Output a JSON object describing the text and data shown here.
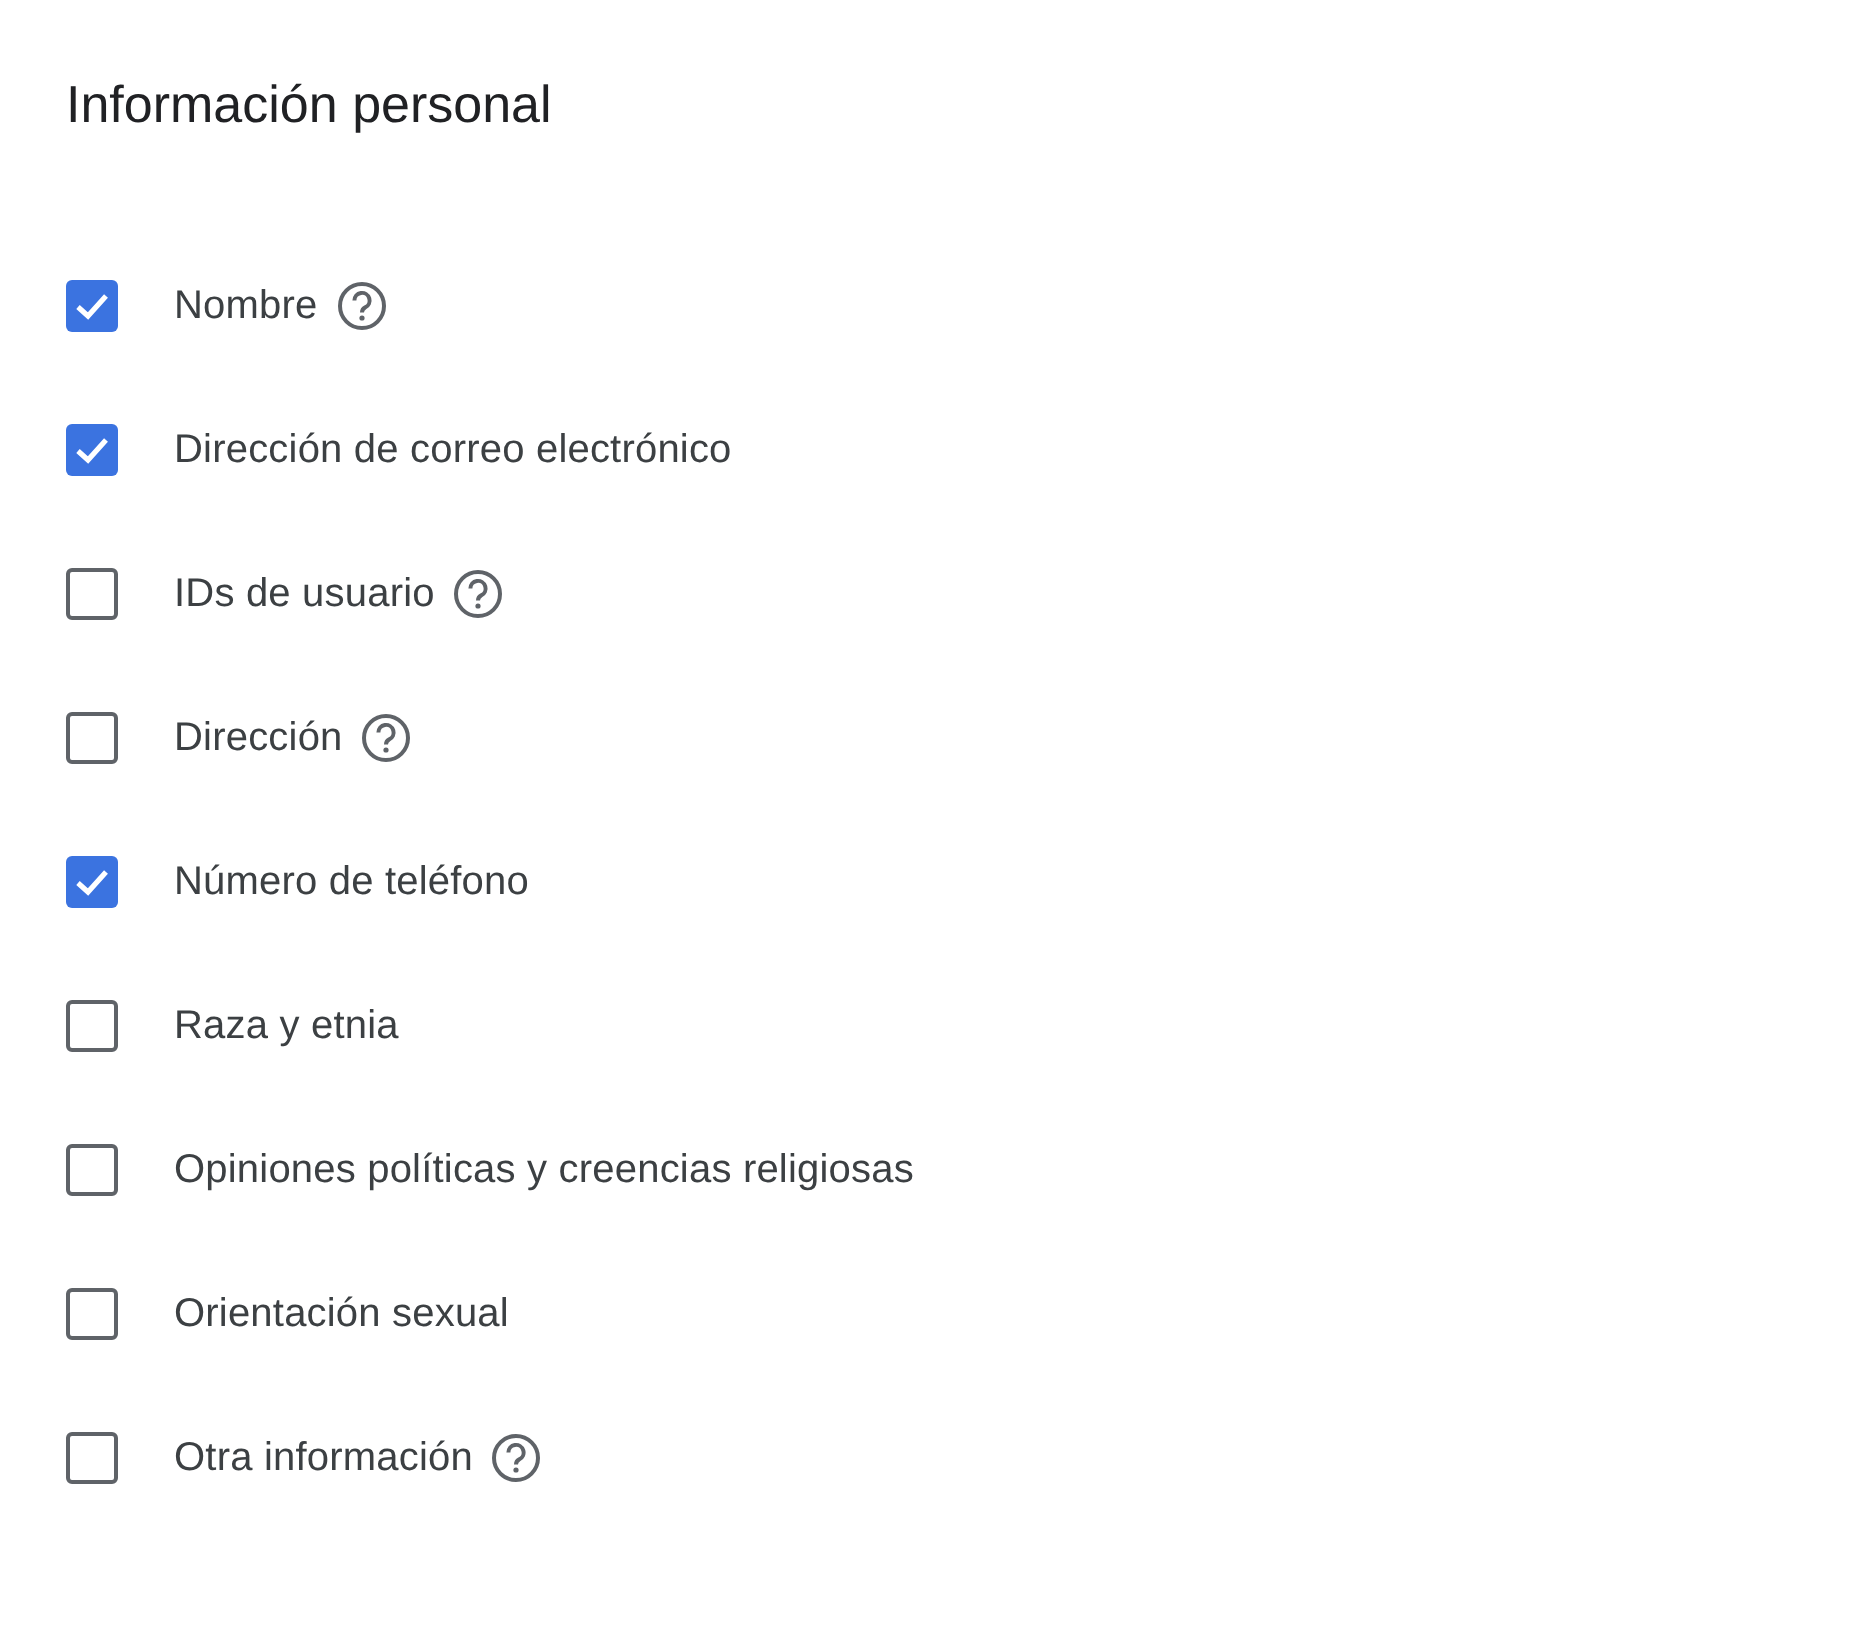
{
  "title": "Información personal",
  "items": [
    {
      "label": "Nombre",
      "checked": true,
      "help": true
    },
    {
      "label": "Dirección de correo electrónico",
      "checked": true,
      "help": false
    },
    {
      "label": "IDs de usuario",
      "checked": false,
      "help": true
    },
    {
      "label": "Dirección",
      "checked": false,
      "help": true
    },
    {
      "label": "Número de teléfono",
      "checked": true,
      "help": false
    },
    {
      "label": "Raza y etnia",
      "checked": false,
      "help": false
    },
    {
      "label": "Opiniones políticas y creencias religiosas",
      "checked": false,
      "help": false
    },
    {
      "label": "Orientación sexual",
      "checked": false,
      "help": false
    },
    {
      "label": "Otra información",
      "checked": false,
      "help": true
    }
  ]
}
